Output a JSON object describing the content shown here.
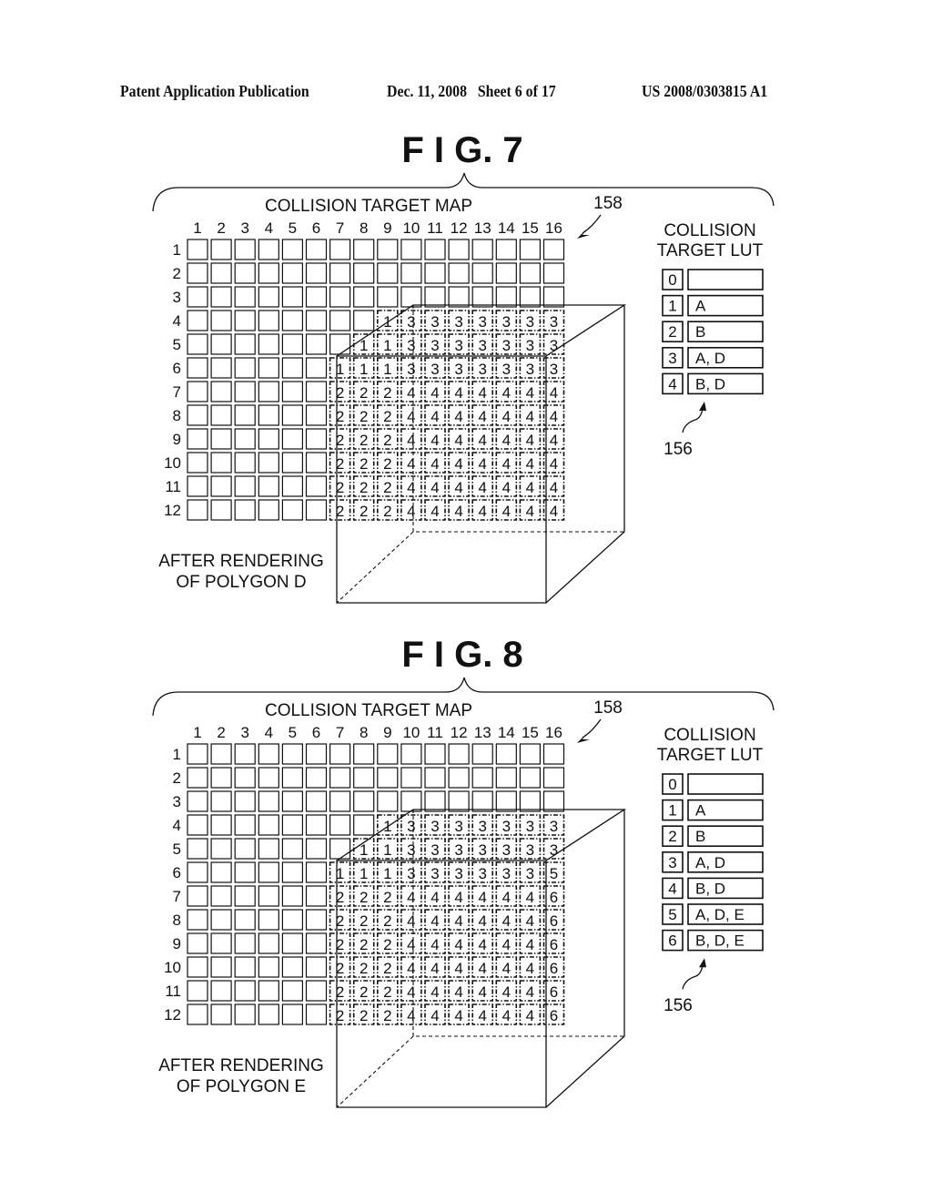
{
  "header": {
    "publication": "Patent Application Publication",
    "date_sheet": "Dec. 11, 2008   Sheet 6 of 17",
    "number": "US 2008/0303815 A1"
  },
  "figures": [
    {
      "title": "F I G. 7",
      "map_title": "COLLISION TARGET MAP",
      "map_ref": "158",
      "caption": [
        "AFTER RENDERING",
        "OF POLYGON D"
      ],
      "columns": [
        "1",
        "2",
        "3",
        "4",
        "5",
        "6",
        "7",
        "8",
        "9",
        "10",
        "11",
        "12",
        "13",
        "14",
        "15",
        "16"
      ],
      "rows": [
        "1",
        "2",
        "3",
        "4",
        "5",
        "6",
        "7",
        "8",
        "9",
        "10",
        "11",
        "12"
      ],
      "cells": [
        [
          "",
          "",
          "",
          "",
          "",
          "",
          "",
          "",
          "",
          "",
          "",
          "",
          "",
          "",
          "",
          ""
        ],
        [
          "",
          "",
          "",
          "",
          "",
          "",
          "",
          "",
          "",
          "",
          "",
          "",
          "",
          "",
          "",
          ""
        ],
        [
          "",
          "",
          "",
          "",
          "",
          "",
          "",
          "",
          "",
          "",
          "",
          "",
          "",
          "",
          "",
          ""
        ],
        [
          "",
          "",
          "",
          "",
          "",
          "",
          "",
          "",
          "1",
          "3",
          "3",
          "3",
          "3",
          "3",
          "3",
          "3"
        ],
        [
          "",
          "",
          "",
          "",
          "",
          "",
          "",
          "1",
          "1",
          "3",
          "3",
          "3",
          "3",
          "3",
          "3",
          "3"
        ],
        [
          "",
          "",
          "",
          "",
          "",
          "",
          "1",
          "1",
          "1",
          "3",
          "3",
          "3",
          "3",
          "3",
          "3",
          "3"
        ],
        [
          "",
          "",
          "",
          "",
          "",
          "",
          "2",
          "2",
          "2",
          "4",
          "4",
          "4",
          "4",
          "4",
          "4",
          "4"
        ],
        [
          "",
          "",
          "",
          "",
          "",
          "",
          "2",
          "2",
          "2",
          "4",
          "4",
          "4",
          "4",
          "4",
          "4",
          "4"
        ],
        [
          "",
          "",
          "",
          "",
          "",
          "",
          "2",
          "2",
          "2",
          "4",
          "4",
          "4",
          "4",
          "4",
          "4",
          "4"
        ],
        [
          "",
          "",
          "",
          "",
          "",
          "",
          "2",
          "2",
          "2",
          "4",
          "4",
          "4",
          "4",
          "4",
          "4",
          "4"
        ],
        [
          "",
          "",
          "",
          "",
          "",
          "",
          "2",
          "2",
          "2",
          "4",
          "4",
          "4",
          "4",
          "4",
          "4",
          "4"
        ],
        [
          "",
          "",
          "",
          "",
          "",
          "",
          "2",
          "2",
          "2",
          "4",
          "4",
          "4",
          "4",
          "4",
          "4",
          "4"
        ]
      ],
      "lut_title": [
        "COLLISION",
        "TARGET LUT"
      ],
      "lut_ref": "156",
      "lut": [
        {
          "index": "0",
          "value": ""
        },
        {
          "index": "1",
          "value": "A"
        },
        {
          "index": "2",
          "value": "B"
        },
        {
          "index": "3",
          "value": "A, D"
        },
        {
          "index": "4",
          "value": "B, D"
        }
      ]
    },
    {
      "title": "F I G. 8",
      "map_title": "COLLISION TARGET MAP",
      "map_ref": "158",
      "caption": [
        "AFTER RENDERING",
        "OF POLYGON E"
      ],
      "columns": [
        "1",
        "2",
        "3",
        "4",
        "5",
        "6",
        "7",
        "8",
        "9",
        "10",
        "11",
        "12",
        "13",
        "14",
        "15",
        "16"
      ],
      "rows": [
        "1",
        "2",
        "3",
        "4",
        "5",
        "6",
        "7",
        "8",
        "9",
        "10",
        "11",
        "12"
      ],
      "cells": [
        [
          "",
          "",
          "",
          "",
          "",
          "",
          "",
          "",
          "",
          "",
          "",
          "",
          "",
          "",
          "",
          ""
        ],
        [
          "",
          "",
          "",
          "",
          "",
          "",
          "",
          "",
          "",
          "",
          "",
          "",
          "",
          "",
          "",
          ""
        ],
        [
          "",
          "",
          "",
          "",
          "",
          "",
          "",
          "",
          "",
          "",
          "",
          "",
          "",
          "",
          "",
          ""
        ],
        [
          "",
          "",
          "",
          "",
          "",
          "",
          "",
          "",
          "1",
          "3",
          "3",
          "3",
          "3",
          "3",
          "3",
          "3"
        ],
        [
          "",
          "",
          "",
          "",
          "",
          "",
          "",
          "1",
          "1",
          "3",
          "3",
          "3",
          "3",
          "3",
          "3",
          "3"
        ],
        [
          "",
          "",
          "",
          "",
          "",
          "",
          "1",
          "1",
          "1",
          "3",
          "3",
          "3",
          "3",
          "3",
          "3",
          "5"
        ],
        [
          "",
          "",
          "",
          "",
          "",
          "",
          "2",
          "2",
          "2",
          "4",
          "4",
          "4",
          "4",
          "4",
          "4",
          "6"
        ],
        [
          "",
          "",
          "",
          "",
          "",
          "",
          "2",
          "2",
          "2",
          "4",
          "4",
          "4",
          "4",
          "4",
          "4",
          "6"
        ],
        [
          "",
          "",
          "",
          "",
          "",
          "",
          "2",
          "2",
          "2",
          "4",
          "4",
          "4",
          "4",
          "4",
          "4",
          "6"
        ],
        [
          "",
          "",
          "",
          "",
          "",
          "",
          "2",
          "2",
          "2",
          "4",
          "4",
          "4",
          "4",
          "4",
          "4",
          "6"
        ],
        [
          "",
          "",
          "",
          "",
          "",
          "",
          "2",
          "2",
          "2",
          "4",
          "4",
          "4",
          "4",
          "4",
          "4",
          "6"
        ],
        [
          "",
          "",
          "",
          "",
          "",
          "",
          "2",
          "2",
          "2",
          "4",
          "4",
          "4",
          "4",
          "4",
          "4",
          "6"
        ]
      ],
      "lut_title": [
        "COLLISION",
        "TARGET LUT"
      ],
      "lut_ref": "156",
      "lut": [
        {
          "index": "0",
          "value": ""
        },
        {
          "index": "1",
          "value": "A"
        },
        {
          "index": "2",
          "value": "B"
        },
        {
          "index": "3",
          "value": "A, D"
        },
        {
          "index": "4",
          "value": "B, D"
        },
        {
          "index": "5",
          "value": "A, D, E"
        },
        {
          "index": "6",
          "value": "B, D, E"
        }
      ]
    }
  ]
}
